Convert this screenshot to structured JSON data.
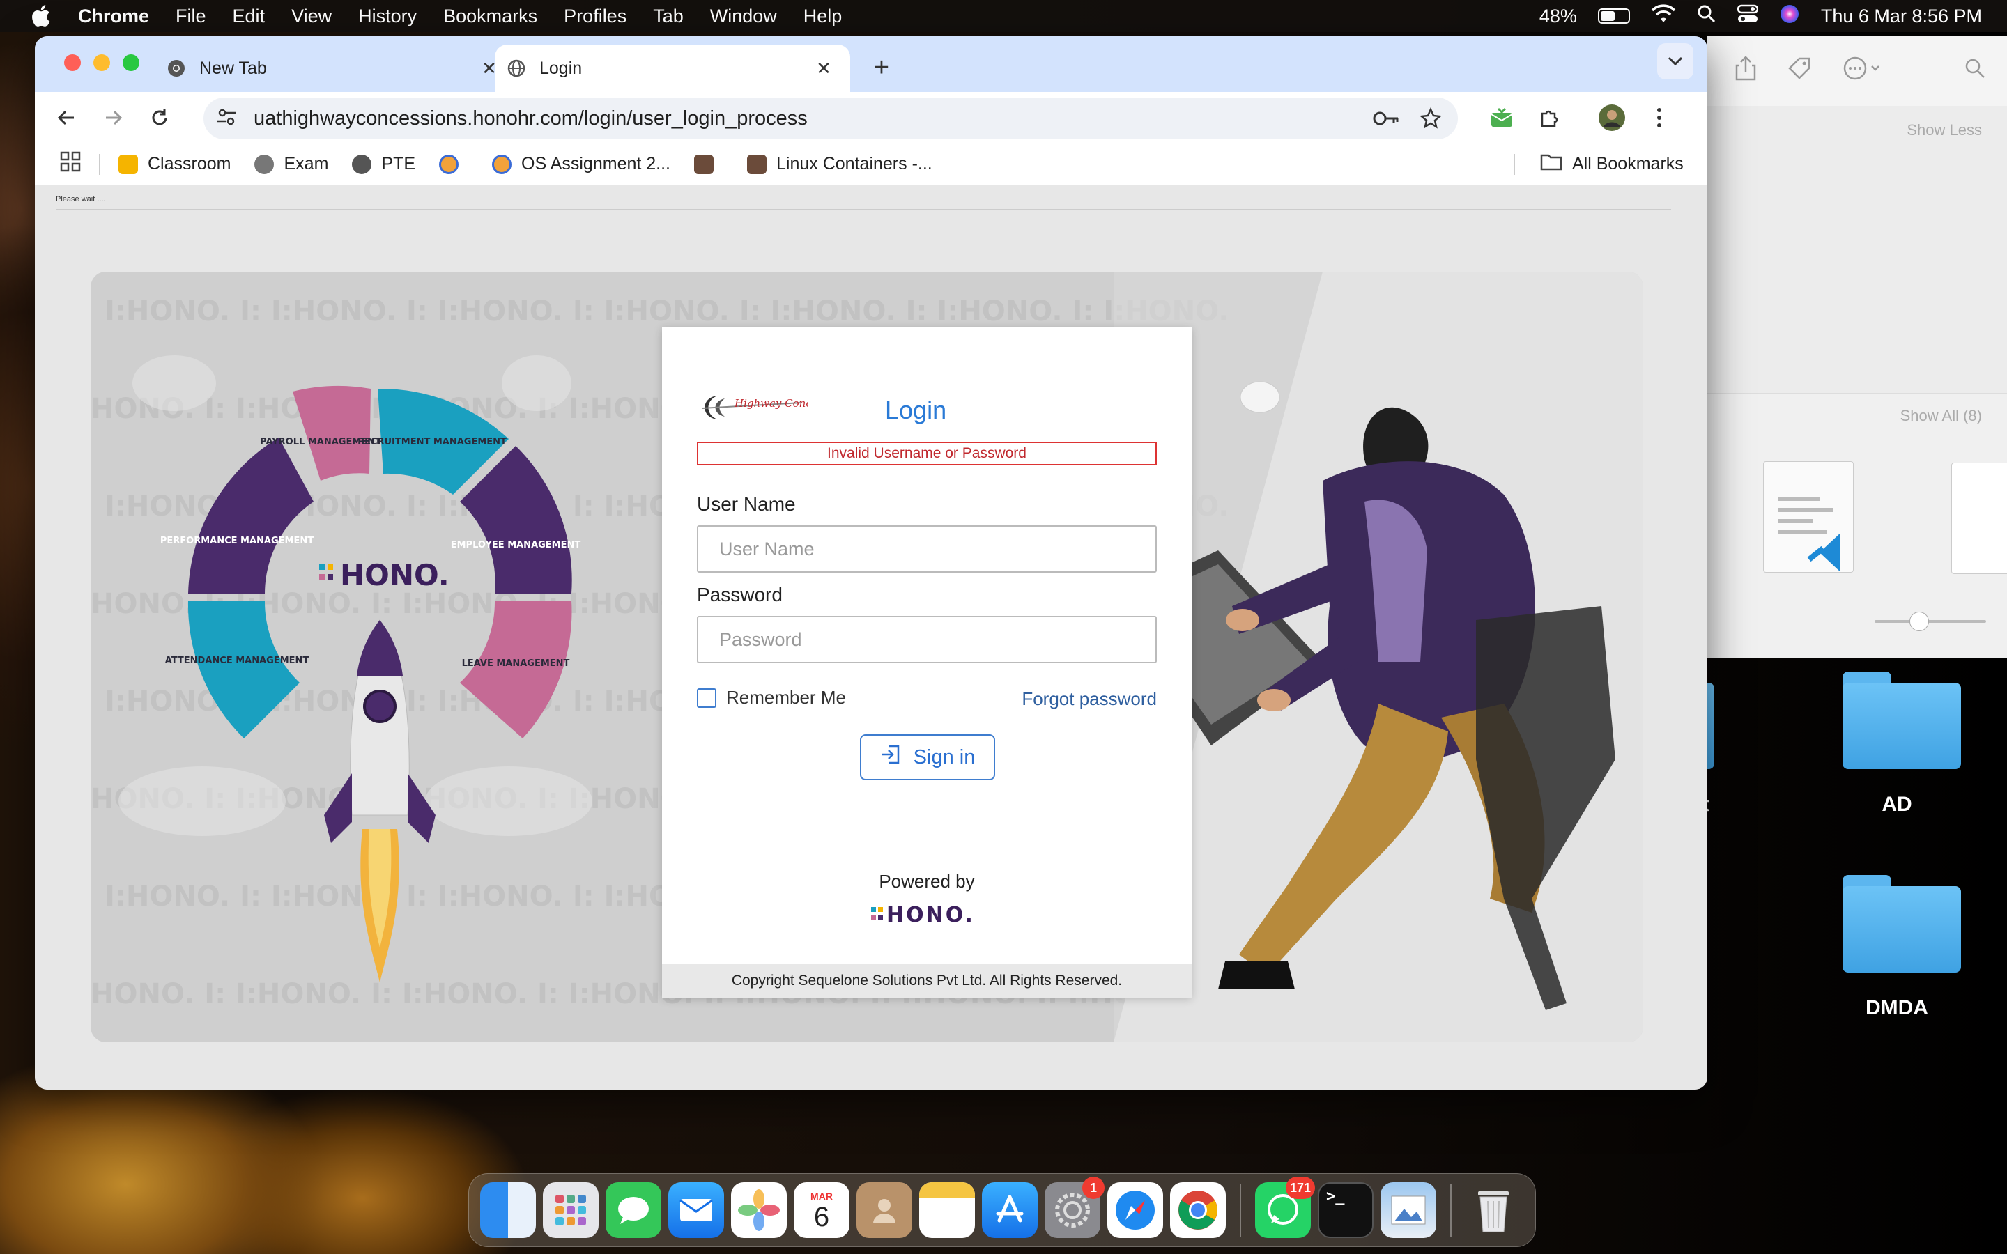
{
  "menubar": {
    "app": "Chrome",
    "items": [
      "File",
      "Edit",
      "View",
      "History",
      "Bookmarks",
      "Profiles",
      "Tab",
      "Window",
      "Help"
    ],
    "battery": "48%",
    "datetime": "Thu 6 Mar  8:56 PM"
  },
  "browser": {
    "tabs": [
      {
        "title": "New Tab"
      },
      {
        "title": "Login"
      }
    ],
    "url": "uathighwayconcessions.honohr.com/login/user_login_process",
    "bookmarks": [
      "Classroom",
      "Exam",
      "PTE",
      "",
      "OS Assignment 2...",
      "",
      "Linux Containers -..."
    ],
    "all_bookmarks": "All Bookmarks"
  },
  "page": {
    "please_wait": "Please wait ....",
    "login": {
      "title": "Login",
      "error": "Invalid Username or Password",
      "username_label": "User Name",
      "username_placeholder": "User Name",
      "password_label": "Password",
      "password_placeholder": "Password",
      "remember_me": "Remember Me",
      "forgot_password": "Forgot password",
      "sign_in": "Sign in",
      "powered_by": "Powered by",
      "footer": "Copyright Sequelone Solutions Pvt Ltd. All Rights Reserved."
    },
    "logo_text": "Highway Concessions",
    "hono_brand": "HONO.",
    "wheel_segments": [
      "PAYROLL MANAGEMENT",
      "RECRUITMENT MANAGEMENT",
      "PERFORMANCE MANAGEMENT",
      "EMPLOYEE MANAGEMENT",
      "ATTENDANCE MANAGEMENT",
      "LEAVE MANAGEMENT"
    ]
  },
  "finder": {
    "show_less": "Show Less",
    "show_all": "Show All (8)"
  },
  "desktop": {
    "folders": [
      "AD",
      "DMDA"
    ],
    "partial_labels": [
      "ct",
      "A"
    ]
  },
  "dock": {
    "calendar_month": "MAR",
    "calendar_day": "6",
    "settings_badge": "1",
    "whatsapp_badge": "171"
  },
  "colors": {
    "accent": "#2a7ad6",
    "error": "#c0282e",
    "hono_purple": "#3b1f5c"
  }
}
